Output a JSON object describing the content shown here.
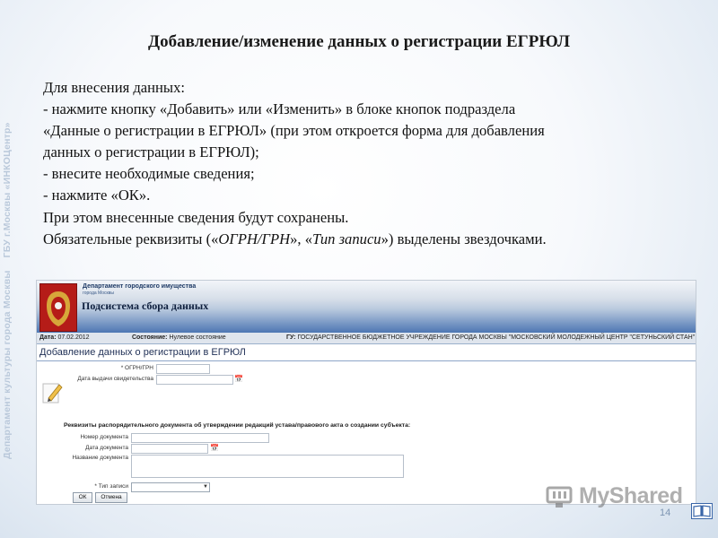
{
  "sidebar_text": [
    "Департамент культуры города Москвы",
    "ГБУ г.Москвы «ИНКОЦентр»"
  ],
  "slide": {
    "title": "Добавление/изменение данных о регистрации ЕГРЮЛ",
    "lines": [
      "Для внесения данных:",
      "- нажмите кнопку «Добавить» или «Изменить» в блоке кнопок подраздела",
      "«Данные о регистрации в ЕГРЮЛ» (при этом откроется форма для добавления",
      "данных о регистрации в ЕГРЮЛ);",
      "- внесите необходимые сведения;",
      "- нажмите «ОК».",
      "При этом внесенные сведения будут сохранены."
    ],
    "last_line": {
      "part1": "Обязательные реквизиты («",
      "em1": "ОГРН/ГРН",
      "part2": "», «",
      "em2": "Тип записи",
      "part3": "») выделены звездочками."
    }
  },
  "ui": {
    "header": {
      "dept": "Департамент городского имущества",
      "city": "города Москвы",
      "subsystem": "Подсистема сбора данных"
    },
    "info": {
      "date_label": "Дата:",
      "date_value": "07.02.2012",
      "state_label": "Состояние:",
      "state_value": "Нулевое состояние",
      "org_label": "ГУ:",
      "org_value": "ГОСУДАРСТВЕННОЕ БЮДЖЕТНОЕ УЧРЕЖДЕНИЕ ГОРОДА МОСКВЫ \"МОСКОВСКИЙ МОЛОДЕЖНЫЙ ЦЕНТР \"СЕТУНЬСКИЙ СТАН\""
    },
    "form_title": "Добавление данных о регистрации в ЕГРЮЛ",
    "fields": {
      "ogrn_label": "* ОГРН/ГРН",
      "cert_date_label": "Дата выдачи свидетельства",
      "section_label": "Реквизиты распорядительного документа об утверждении редакций устава/правового акта о создании субъекта:",
      "doc_number_label": "Номер документа",
      "doc_date_label": "Дата документа",
      "doc_name_label": "Название документа",
      "record_type_label": "* Тип записи"
    },
    "buttons": {
      "ok": "ОК",
      "cancel": "Отмена"
    }
  },
  "watermark": "MyShared",
  "page_number": "14",
  "colors": {
    "accent": "#4d76b3",
    "side_text": "#b9c8da"
  },
  "icons": [
    "emblem-icon",
    "pencil-icon",
    "calendar-icon",
    "dropdown-arrow-icon",
    "myshared-logo-icon",
    "book-icon"
  ]
}
